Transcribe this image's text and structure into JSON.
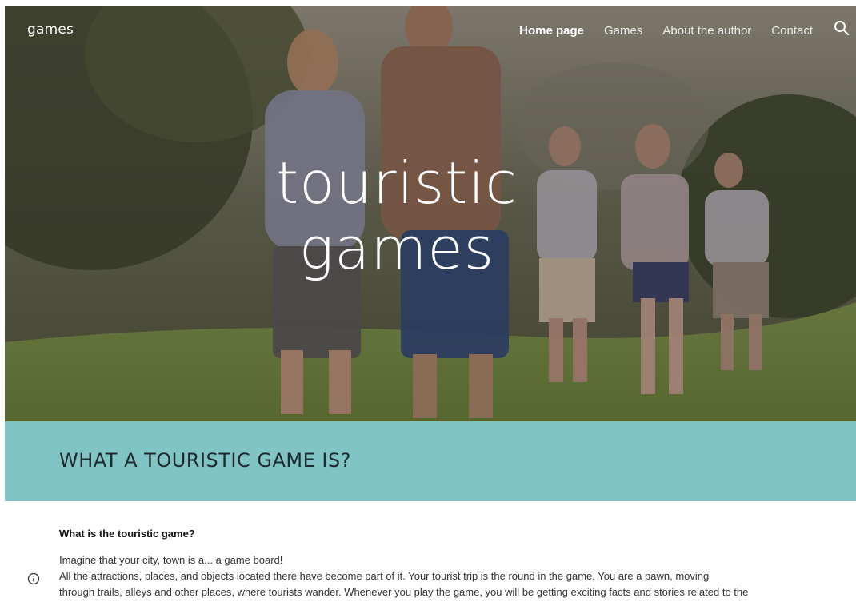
{
  "site": {
    "name": "games"
  },
  "nav": {
    "items": [
      {
        "label": "Home page",
        "active": true
      },
      {
        "label": "Games",
        "active": false
      },
      {
        "label": "About the author",
        "active": false
      },
      {
        "label": "Contact",
        "active": false
      }
    ],
    "search_icon": "search-icon"
  },
  "hero": {
    "title_line1": "touristic",
    "title_line2": "games"
  },
  "banner": {
    "heading": "WHAT A TOURISTIC GAME IS?",
    "color": "#80c4c5"
  },
  "content": {
    "subheading": "What is the touristic game?",
    "line1": "Imagine that your city, town is a... a game board!",
    "line2": "All the attractions, places, and objects located there have become part of it. Your tourist trip is the round in the game. You are a pawn, moving",
    "line3": "through trails, alleys and other places, where tourists wander. Whenever you play the game, you will be getting exciting facts and stories related to the"
  },
  "info_icon": "info-icon"
}
